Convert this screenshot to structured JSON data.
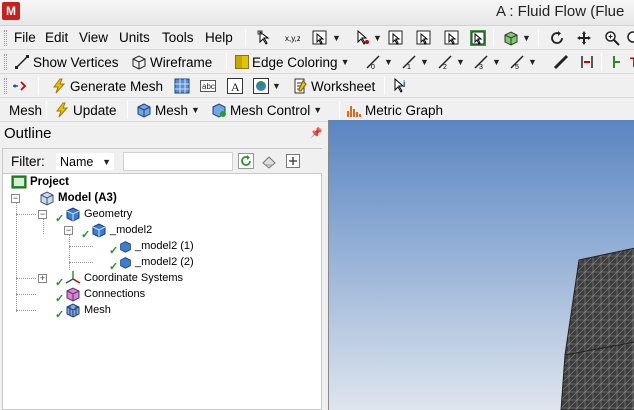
{
  "window": {
    "title": "A : Fluid Flow (Flue"
  },
  "menu": [
    "File",
    "Edit",
    "View",
    "Units",
    "Tools",
    "Help"
  ],
  "toolbar1": {
    "show_vertices": "Show Vertices",
    "wireframe": "Wireframe",
    "edge_coloring": "Edge Coloring",
    "partial": "T"
  },
  "toolbar2": {
    "generate_mesh": "Generate Mesh",
    "worksheet": "Worksheet"
  },
  "toolbar3": {
    "mesh_label": "Mesh",
    "update": "Update",
    "mesh_menu": "Mesh",
    "mesh_control": "Mesh Control",
    "metric_graph": "Metric Graph"
  },
  "outline": {
    "title": "Outline",
    "filter_label": "Filter:",
    "filter_value": "Name",
    "filter_text": ""
  },
  "tree": [
    {
      "label": "Project"
    },
    {
      "label": "Model (A3)"
    },
    {
      "label": "Geometry"
    },
    {
      "label": "_model2"
    },
    {
      "label": "_model2 (1)"
    },
    {
      "label": "_model2 (2)"
    },
    {
      "label": "Coordinate Systems"
    },
    {
      "label": "Connections"
    },
    {
      "label": "Mesh"
    }
  ],
  "colors": {
    "check": "#1a9a1a",
    "viewport_top": "#5a85c1",
    "viewport_bottom": "#dfe5ee",
    "mesh_body": "#3d3d3d"
  }
}
